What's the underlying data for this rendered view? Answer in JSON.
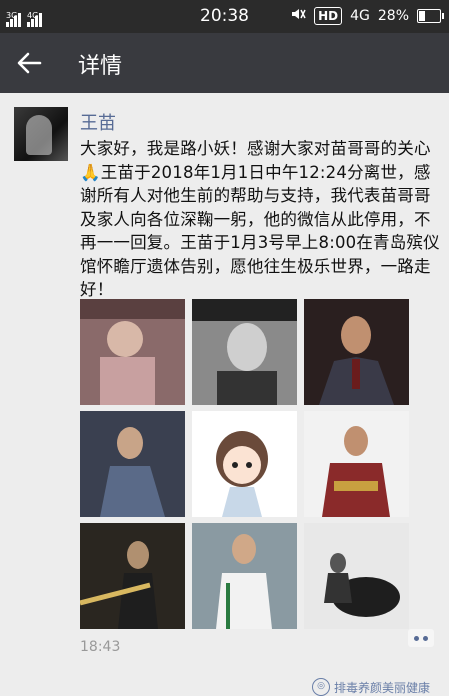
{
  "status_bar": {
    "sim1": "3G",
    "sim2": "4G",
    "time": "20:38",
    "hd_label": "HD",
    "network": "4G",
    "battery": "28%",
    "battery_level": 0.28
  },
  "header": {
    "back_icon": "arrow-left-icon",
    "title": "详情"
  },
  "post": {
    "author": "王苗",
    "text": "大家好，我是路小妖！感谢大家对苗哥哥的关心🙏王苗于2018年1月1日中午12:24分离世，感谢所有人对他生前的帮助与支持，我代表苗哥哥及家人向各位深鞠一躬，他的微信从此停用，不再一一回复。王苗于1月3号早上8:00在青岛殡仪馆怀瞻厅遗体告别，愿他往生极乐世界，一路走好！",
    "photos": [
      {
        "desc": "child-photo",
        "bg": "#8a6a6a"
      },
      {
        "desc": "bw-portrait",
        "bg": "#555555"
      },
      {
        "desc": "suit-portrait",
        "bg": "#3a2a2a"
      },
      {
        "desc": "action-pose",
        "bg": "#4a5060"
      },
      {
        "desc": "cartoon-avatar",
        "bg": "#ffffff"
      },
      {
        "desc": "armor-costume",
        "bg": "#7a3030"
      },
      {
        "desc": "sword-pose",
        "bg": "#3a3530"
      },
      {
        "desc": "kungfu-pose",
        "bg": "#7a8a90"
      },
      {
        "desc": "horse-rider",
        "bg": "#2a2a2a"
      }
    ],
    "time": "18:43"
  },
  "watermark": {
    "text": "排毒养颜美丽健康"
  }
}
